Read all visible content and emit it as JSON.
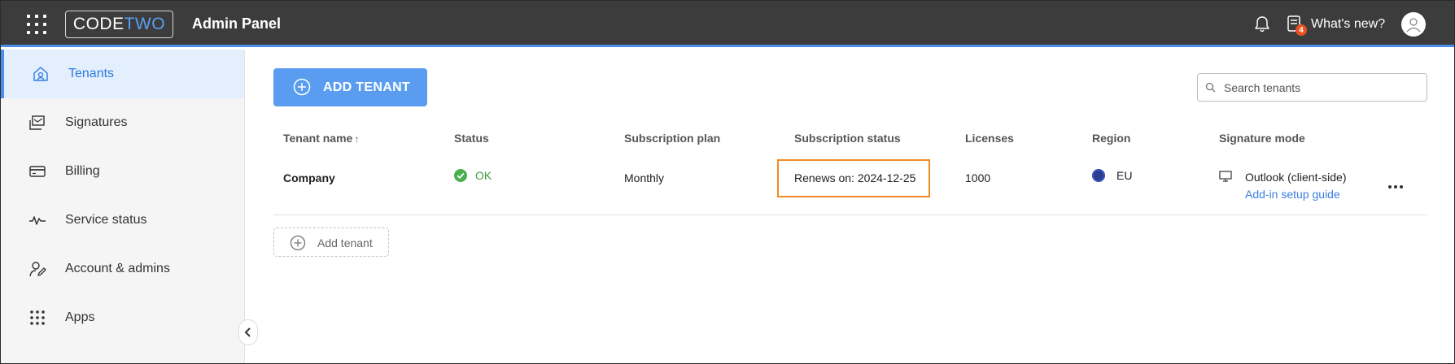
{
  "header": {
    "logo_code": "CODE",
    "logo_two": "TWO",
    "title": "Admin Panel",
    "whats_new_label": "What's new?",
    "whats_new_badge": "4"
  },
  "sidebar": {
    "items": [
      {
        "label": "Tenants",
        "icon": "home-icon",
        "active": true
      },
      {
        "label": "Signatures",
        "icon": "signatures-icon",
        "active": false
      },
      {
        "label": "Billing",
        "icon": "credit-card-icon",
        "active": false
      },
      {
        "label": "Service status",
        "icon": "pulse-icon",
        "active": false
      },
      {
        "label": "Account & admins",
        "icon": "user-edit-icon",
        "active": false
      },
      {
        "label": "Apps",
        "icon": "apps-grid-icon",
        "active": false
      }
    ]
  },
  "main": {
    "add_tenant_button": "ADD TENANT",
    "search_placeholder": "Search tenants",
    "columns": {
      "tenant_name": "Tenant name",
      "sort_indicator": "↑",
      "status": "Status",
      "subscription_plan": "Subscription plan",
      "subscription_status": "Subscription status",
      "licenses": "Licenses",
      "region": "Region",
      "signature_mode": "Signature mode"
    },
    "rows": [
      {
        "tenant_name": "Company",
        "status": "OK",
        "subscription_plan": "Monthly",
        "subscription_status": "Renews on: 2024-12-25",
        "licenses": "1000",
        "region": "EU",
        "signature_mode": "Outlook (client-side)",
        "signature_mode_link": "Add-in setup guide"
      }
    ],
    "add_tenant_link": "Add tenant"
  },
  "colors": {
    "topbar": "#3c3c3c",
    "accent": "#4a8fe7",
    "primary_button": "#5a9df0",
    "ok_green": "#3f9b3f",
    "highlight_orange": "#f08a24",
    "badge": "#e8511f"
  }
}
